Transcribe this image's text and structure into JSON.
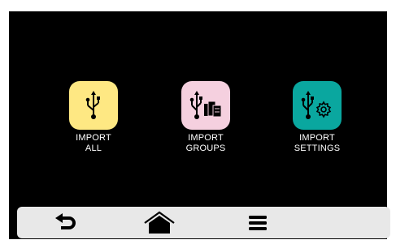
{
  "colors": {
    "screen_bg": "#000000",
    "import_all_bg": "#fee883",
    "import_groups_bg": "#f5d0df",
    "import_settings_bg": "#0aa79f",
    "nav_bar_bg": "#e8e8e8",
    "label_color": "#ffffff"
  },
  "tiles": [
    {
      "name": "import-all",
      "icon": "usb-icon",
      "label_line1": "IMPORT",
      "label_line2": "ALL"
    },
    {
      "name": "import-groups",
      "icon": "usb-groups-icon",
      "label_line1": "IMPORT",
      "label_line2": "GROUPS"
    },
    {
      "name": "import-settings",
      "icon": "usb-settings-icon",
      "label_line1": "IMPORT",
      "label_line2": "SETTINGS"
    }
  ],
  "nav": {
    "items": [
      {
        "name": "back",
        "icon": "back-arrow-icon"
      },
      {
        "name": "home",
        "icon": "home-icon"
      },
      {
        "name": "menu",
        "icon": "hamburger-menu-icon"
      }
    ]
  }
}
